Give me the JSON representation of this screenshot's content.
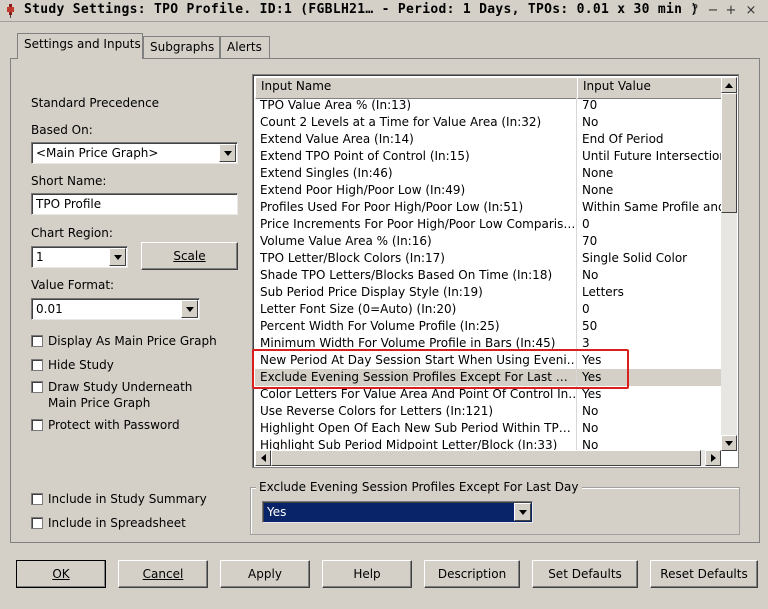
{
  "window": {
    "title": "Study Settings: TPO Profile. ID:1 (FGBLH21… - Period: 1 Days, TPOs: 0.01 x 30 min  )",
    "controls": [
      "?",
      "−",
      "+",
      "×"
    ]
  },
  "tabs": [
    {
      "label": "Settings and Inputs",
      "active": true
    },
    {
      "label": "Subgraphs",
      "active": false
    },
    {
      "label": "Alerts",
      "active": false
    }
  ],
  "left": {
    "standard_precedence": "Standard Precedence",
    "based_on_label": "Based On:",
    "based_on_value": "<Main Price Graph>",
    "short_name_label": "Short Name:",
    "short_name_value": "TPO Profile",
    "chart_region_label": "Chart Region:",
    "chart_region_value": "1",
    "scale_button": "Scale",
    "value_format_label": "Value Format:",
    "value_format_value": "0.01",
    "checks": [
      "Display As Main Price Graph",
      "Hide Study",
      "Draw Study Underneath",
      "Main Price Graph",
      "Protect with Password"
    ],
    "check_bottom": [
      "Include in Study Summary",
      "Include in Spreadsheet"
    ]
  },
  "grid": {
    "col_name": "Input Name",
    "col_value": "Input Value",
    "rows": [
      {
        "name": "TPO Value Area %   (In:13)",
        "value": "70"
      },
      {
        "name": "Count 2 Levels at a Time for Value Area   (In:32)",
        "value": "No"
      },
      {
        "name": "Extend Value Area   (In:14)",
        "value": "End Of Period"
      },
      {
        "name": "Extend TPO Point of Control   (In:15)",
        "value": "Until Future Intersection"
      },
      {
        "name": "Extend Singles   (In:46)",
        "value": "None"
      },
      {
        "name": "Extend Poor High/Poor Low   (In:49)",
        "value": "None"
      },
      {
        "name": "Profiles Used For Poor High/Poor Low   (In:51)",
        "value": "Within Same Profile and"
      },
      {
        "name": "Price Increments For Poor High/Poor Low Comparis…",
        "value": "0"
      },
      {
        "name": "Volume Value Area %   (In:16)",
        "value": "70"
      },
      {
        "name": "TPO Letter/Block Colors   (In:17)",
        "value": "Single Solid Color"
      },
      {
        "name": "Shade TPO Letters/Blocks Based On Time   (In:18)",
        "value": "No"
      },
      {
        "name": "Sub Period Price Display Style   (In:19)",
        "value": "Letters"
      },
      {
        "name": "Letter Font Size (0=Auto)   (In:20)",
        "value": "0"
      },
      {
        "name": "Percent Width For Volume Profile   (In:25)",
        "value": "50"
      },
      {
        "name": "Minimum Width For Volume Profile in Bars   (In:45)",
        "value": "3"
      },
      {
        "name": "New Period At Day Session Start When Using Eveni…",
        "value": "Yes"
      },
      {
        "name": "Exclude Evening Session Profiles Except For Last …",
        "value": "Yes"
      },
      {
        "name": "Color Letters For Value Area And Point Of Control In…",
        "value": "Yes"
      },
      {
        "name": "Use Reverse Colors for Letters   (In:121)",
        "value": "No"
      },
      {
        "name": "Highlight Open Of Each New Sub Period Within TP…",
        "value": "No"
      },
      {
        "name": "Highlight Sub Period Midpoint Letter/Block   (In:33)",
        "value": "No"
      }
    ],
    "selected_row": 16
  },
  "editor": {
    "label": "Exclude Evening Session Profiles Except For Last Day",
    "value": "Yes"
  },
  "buttons": {
    "ok": "OK",
    "cancel": "Cancel",
    "apply": "Apply",
    "help": "Help",
    "description": "Description",
    "set_defaults": "Set Defaults",
    "reset_defaults": "Reset Defaults"
  },
  "colors": {
    "highlight_box": "#d9201f",
    "selected_combo": "#0a246a"
  }
}
